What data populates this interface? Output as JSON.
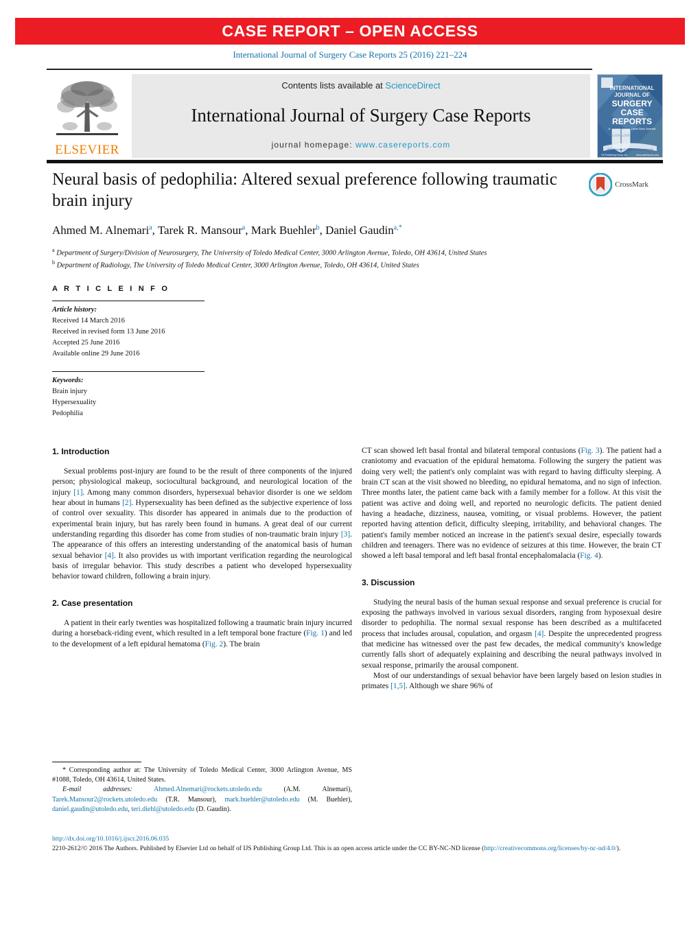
{
  "banner": {
    "label": "CASE REPORT – OPEN ACCESS",
    "color": "#ec1c24"
  },
  "citation": "International Journal of Surgery Case Reports 25 (2016) 221–224",
  "masthead": {
    "publisher": "ELSEVIER",
    "contents_prefix": "Contents lists available at ",
    "contents_link": "ScienceDirect",
    "journal_name": "International Journal of Surgery Case Reports",
    "homepage_prefix": "journal homepage: ",
    "homepage_url": "www.casereports.com",
    "cover": {
      "line1": "INTERNATIONAL",
      "line2": "JOURNAL OF",
      "line3": "SURGERY",
      "line4": "CASE",
      "line5": "REPORTS",
      "tagline": "A Monthly Clinical and Case Journal",
      "ribbon": "Official Journal of the Surgical Associates Ltd",
      "footer_left": "IJS Publishing Group Ltd",
      "footer_right": "www.casereports.com",
      "color": "#3f6fa8"
    }
  },
  "article": {
    "title": "Neural basis of pedophilia: Altered sexual preference following traumatic brain injury",
    "authors_html": "Ahmed M. Alnemari<sup>a</sup>, Tarek R. Mansour<sup>a</sup>, Mark Buehler<sup>b</sup>, Daniel Gaudin<sup>a,*</sup>",
    "affiliation_a": "Department of Surgery/Division of Neurosurgery, The University of Toledo Medical Center, 3000 Arlington Avenue, Toledo, OH 43614, United States",
    "affiliation_b": "Department of Radiology, The University of Toledo Medical Center, 3000 Arlington Avenue, Toledo, OH 43614, United States",
    "crossmark_label": "CrossMark"
  },
  "article_info": {
    "heading": "A R T I C L E    I N F O",
    "history_label": "Article history:",
    "history": [
      "Received 14 March 2016",
      "Received in revised form 13 June 2016",
      "Accepted 25 June 2016",
      "Available online 29 June 2016"
    ],
    "keywords_label": "Keywords:",
    "keywords": [
      "Brain injury",
      "Hypersexuality",
      "Pedophilia"
    ]
  },
  "sections": {
    "intro_heading": "1.  Introduction",
    "intro_p1_html": "Sexual problems post-injury are found to be the result of three components of the injured person; physiological makeup, sociocultural background, and neurological location of the injury <span class=\"ref\">[1]</span>. Among many common disorders, hypersexual behavior disorder is one we seldom hear about in humans <span class=\"ref\">[2]</span>. Hypersexuality has been defined as the subjective experience of loss of control over sexuality. This disorder has appeared in animals due to the production of experimental brain injury, but has rarely been found in humans. A great deal of our current understanding regarding this disorder has come from studies of non-traumatic brain injury <span class=\"ref\">[3]</span>. The appearance of this offers an interesting understanding of the anatomical basis of human sexual behavior <span class=\"ref\">[4]</span>. It also provides us with important verification regarding the neurological basis of irregular behavior. This study describes a patient who developed hypersexuality behavior toward children, following a brain injury.",
    "case_heading": "2.  Case presentation",
    "case_p1_html": "A patient in their early twenties was hospitalized following a traumatic brain injury incurred during a horseback-riding event, which resulted in a left temporal bone fracture (<span class=\"ref\">Fig. 1</span>) and led to the development of a left epidural hematoma (<span class=\"ref\">Fig. 2</span>). The brain",
    "case_p1_cont_html": "CT scan showed left basal frontal and bilateral temporal contusions (<span class=\"ref\">Fig. 3</span>). The patient had a craniotomy and evacuation of the epidural hematoma. Following the surgery the patient was doing very well; the patient's only complaint was with regard to having difficulty sleeping. A brain CT scan at the visit showed no bleeding, no epidural hematoma, and no sign of infection. Three months later, the patient came back with a family member for a follow. At this visit the patient was active and doing well, and reported no neurologic deficits. The patient denied having a headache, dizziness, nausea, vomiting, or visual problems. However, the patient reported having attention deficit, difficulty sleeping, irritability, and behavioral changes. The patient's family member noticed an increase in the patient's sexual desire, especially towards children and teenagers. There was no evidence of seizures at this time. However, the brain CT showed a left basal temporal and left basal frontal encephalomalacia (<span class=\"ref\">Fig. 4</span>).",
    "discussion_heading": "3.  Discussion",
    "discussion_p1_html": "Studying the neural basis of the human sexual response and sexual preference is crucial for exposing the pathways involved in various sexual disorders, ranging from hyposexual desire disorder to pedophilia. The normal sexual response has been described as a multifaceted process that includes arousal, copulation, and orgasm <span class=\"ref\">[4]</span>. Despite the unprecedented progress that medicine has witnessed over the past few decades, the medical community's knowledge currently falls short of adequately explaining and describing the neural pathways involved in sexual response, primarily the arousal component.",
    "discussion_p2_html": "Most of our understandings of sexual behavior have been largely based on lesion studies in primates <span class=\"ref\">[1,5]</span>. Although we share 96% of"
  },
  "footnote": {
    "corresponding_html": "* Corresponding author at: The University of Toledo Medical Center, 3000 Arlington Avenue, MS #1088, Toledo, OH 43614, United States.",
    "emails_html": "<span class=\"em\">E-mail addresses:</span> <span class=\"lnk\">Ahmed.Alnemari@rockets.utoledo.edu</span> (A.M. Alnemari), <span class=\"lnk\">Tarek.Mansour2@rockets.utoledo.edu</span> (T.R. Mansour), <span class=\"lnk\">mark.buehler@utoledo.edu</span> (M. Buehler), <span class=\"lnk\">daniel.gaudin@utoledo.edu</span>, <span class=\"lnk\">teri.diehl@utoledo.edu</span> (D. Gaudin)."
  },
  "publisher_footer": {
    "doi": "http://dx.doi.org/10.1016/j.ijscr.2016.06.035",
    "license_html": "2210-2612/© 2016 The Authors. Published by Elsevier Ltd on behalf of IJS Publishing Group Ltd. This is an open access article under the CC BY-NC-ND license (<span class=\"lnk\">http://creativecommons.org/licenses/by-nc-nd/4.0/</span>)."
  },
  "colors": {
    "accent_red": "#ec1c24",
    "link_blue": "#1272a8",
    "science_direct_blue": "#2196c4",
    "elsevier_orange": "#f07d00",
    "cover_blue": "#3f6fa8"
  }
}
